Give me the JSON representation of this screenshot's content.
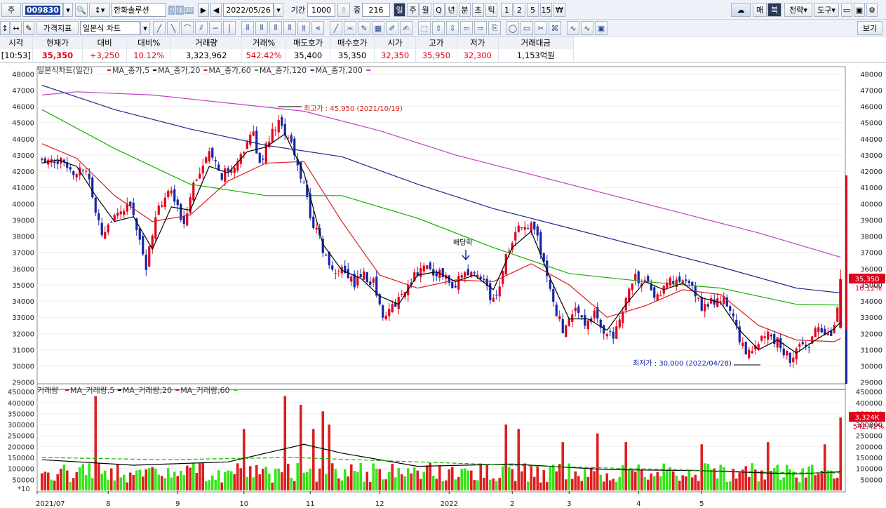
{
  "toolbar1": {
    "code_prefix": "주",
    "stock_code": "009830",
    "stock_name": "한화솔루션",
    "badges": [
      "신",
      "대",
      "30"
    ],
    "date": "2022/05/26",
    "period_label": "기간",
    "period_value": "1000",
    "zoom_label": "중",
    "zoom_value": "216",
    "periods": [
      "일",
      "주",
      "월",
      "Q",
      "년",
      "분",
      "초",
      "틱",
      "1",
      "2",
      "5",
      "15",
      "₩"
    ],
    "active_period": "일",
    "right_buttons": [
      "매",
      "복",
      "전략",
      "도구"
    ]
  },
  "toolbar2": {
    "price_indicator": "가격지표",
    "chart_type": "일본식 차트",
    "view_button": "보기"
  },
  "quote": {
    "headers": [
      "시각",
      "현재가",
      "대비",
      "대비%",
      "거래량",
      "거래%",
      "매도호가",
      "매수호가",
      "시가",
      "고가",
      "저가",
      "거래대금"
    ],
    "time": "[10:53]",
    "current": "35,350",
    "change": "+3,250",
    "change_pct": "10.12%",
    "volume": "3,323,962",
    "volume_pct": "542.42%",
    "ask": "35,400",
    "bid": "35,350",
    "open": "32,350",
    "high": "35,950",
    "low": "32,300",
    "amount": "1,153억원"
  },
  "colors": {
    "up": "#e2001a",
    "down": "#1525a8",
    "ma5": "#000000",
    "ma20": "#d91f1f",
    "ma60": "#16b000",
    "ma120": "#1b2a8f",
    "ma200": "#c33fc3",
    "vol_up": "#dd1f1f",
    "vol_down": "#37e51a"
  },
  "price_legend": {
    "title": "일본식차트(일간)",
    "items": [
      "MA_종가,5",
      "MA_종가,20",
      "MA_종가,60",
      "MA_종가,120",
      "MA_종가,200"
    ]
  },
  "volume_legend": {
    "title": "거래량",
    "items": [
      "MA_거래량,5",
      "MA_거래량,20",
      "MA_거래량,60"
    ],
    "scale_label": "*10"
  },
  "annotations": {
    "high": "최고가 : 45,950 (2021/10/19)",
    "low": "최저가 : 30,000 (2022/04/28)",
    "dividend": "배당락"
  },
  "last_price_tag": "35,350",
  "last_pct_tag": "10.12%",
  "volume_tag": "3,324K",
  "volume_pct_tag": "542.42%",
  "x_axis_labels": [
    "2021/07",
    "8",
    "9",
    "10",
    "11",
    "12",
    "2022",
    "2",
    "3",
    "4",
    "5"
  ],
  "chart_data": {
    "type": "candlestick",
    "title": "일본식차트(일간)",
    "y_ticks": [
      29000,
      30000,
      31000,
      32000,
      33000,
      34000,
      35000,
      36000,
      37000,
      38000,
      39000,
      40000,
      41000,
      42000,
      43000,
      44000,
      45000,
      46000,
      47000,
      48000
    ],
    "ylim": [
      28900,
      48100
    ],
    "volume_ticks": [
      50000,
      100000,
      150000,
      200000,
      250000,
      300000,
      350000,
      400000,
      450000
    ],
    "volume_ylim": [
      0,
      460000
    ],
    "volume_tick_labels": [
      "50000",
      "100000",
      "150000",
      "200000",
      "250000",
      "300000",
      "350000",
      "400000",
      "450000"
    ],
    "close_path": [
      [
        1,
        42600
      ],
      [
        3,
        43000
      ],
      [
        6,
        42600
      ],
      [
        9,
        42500
      ],
      [
        12,
        41900
      ],
      [
        14,
        42200
      ],
      [
        16,
        41700
      ],
      [
        18,
        39400
      ],
      [
        20,
        38300
      ],
      [
        22,
        38800
      ],
      [
        24,
        39000
      ],
      [
        26,
        39200
      ],
      [
        28,
        40000
      ],
      [
        30,
        39400
      ],
      [
        32,
        37800
      ],
      [
        34,
        36200
      ],
      [
        36,
        38000
      ],
      [
        38,
        39700
      ],
      [
        40,
        40300
      ],
      [
        42,
        40700
      ],
      [
        44,
        39600
      ],
      [
        46,
        38800
      ],
      [
        48,
        40700
      ],
      [
        50,
        41800
      ],
      [
        52,
        42300
      ],
      [
        54,
        42900
      ],
      [
        56,
        42300
      ],
      [
        58,
        41800
      ],
      [
        60,
        41900
      ],
      [
        62,
        41900
      ],
      [
        64,
        42900
      ],
      [
        66,
        43900
      ],
      [
        68,
        44300
      ],
      [
        70,
        42300
      ],
      [
        72,
        43800
      ],
      [
        74,
        44400
      ],
      [
        76,
        45100
      ],
      [
        78,
        44100
      ],
      [
        80,
        43600
      ],
      [
        82,
        42300
      ],
      [
        84,
        41300
      ],
      [
        86,
        39200
      ],
      [
        88,
        38300
      ],
      [
        90,
        37100
      ],
      [
        92,
        36200
      ],
      [
        94,
        35800
      ],
      [
        96,
        36100
      ],
      [
        98,
        35500
      ],
      [
        100,
        35100
      ],
      [
        102,
        35600
      ],
      [
        104,
        35400
      ],
      [
        106,
        35200
      ],
      [
        108,
        33800
      ],
      [
        110,
        32800
      ],
      [
        112,
        33600
      ],
      [
        114,
        34200
      ],
      [
        116,
        34700
      ],
      [
        118,
        35300
      ],
      [
        120,
        35900
      ],
      [
        122,
        36200
      ],
      [
        124,
        35800
      ],
      [
        126,
        35800
      ],
      [
        128,
        35700
      ],
      [
        130,
        35300
      ],
      [
        132,
        34900
      ],
      [
        134,
        35700
      ],
      [
        136,
        35700
      ],
      [
        138,
        35500
      ],
      [
        140,
        35600
      ],
      [
        142,
        34800
      ],
      [
        144,
        33900
      ],
      [
        146,
        35100
      ],
      [
        148,
        36700
      ],
      [
        150,
        37600
      ],
      [
        152,
        38300
      ],
      [
        154,
        38800
      ],
      [
        156,
        38500
      ],
      [
        158,
        37900
      ],
      [
        160,
        36400
      ],
      [
        162,
        34700
      ],
      [
        164,
        33300
      ],
      [
        166,
        32300
      ],
      [
        168,
        33200
      ],
      [
        170,
        33600
      ],
      [
        172,
        32700
      ],
      [
        174,
        32900
      ],
      [
        176,
        33100
      ],
      [
        178,
        32400
      ],
      [
        180,
        32100
      ],
      [
        182,
        31600
      ],
      [
        184,
        32600
      ],
      [
        186,
        34200
      ],
      [
        188,
        35400
      ],
      [
        190,
        35300
      ],
      [
        192,
        35100
      ],
      [
        194,
        34600
      ],
      [
        196,
        34300
      ],
      [
        198,
        35100
      ],
      [
        200,
        35300
      ],
      [
        202,
        35100
      ],
      [
        204,
        35000
      ],
      [
        206,
        35000
      ],
      [
        208,
        34400
      ],
      [
        210,
        33700
      ],
      [
        212,
        33800
      ],
      [
        214,
        34100
      ],
      [
        216,
        34100
      ],
      [
        218,
        33800
      ],
      [
        220,
        32800
      ],
      [
        222,
        31800
      ],
      [
        224,
        30400
      ],
      [
        226,
        31000
      ],
      [
        228,
        31600
      ],
      [
        230,
        31900
      ],
      [
        232,
        31800
      ],
      [
        234,
        31500
      ],
      [
        236,
        30800
      ],
      [
        238,
        30400
      ],
      [
        240,
        30900
      ],
      [
        242,
        31200
      ],
      [
        244,
        31400
      ],
      [
        246,
        32100
      ],
      [
        248,
        32400
      ],
      [
        250,
        31900
      ],
      [
        252,
        32300
      ],
      [
        254,
        35350
      ]
    ],
    "ma5": [
      [
        1,
        42500
      ],
      [
        6,
        42700
      ],
      [
        12,
        42300
      ],
      [
        18,
        40500
      ],
      [
        24,
        38900
      ],
      [
        30,
        39200
      ],
      [
        36,
        37200
      ],
      [
        42,
        39800
      ],
      [
        48,
        39600
      ],
      [
        54,
        42300
      ],
      [
        60,
        41900
      ],
      [
        66,
        43200
      ],
      [
        72,
        43500
      ],
      [
        78,
        44300
      ],
      [
        84,
        41900
      ],
      [
        90,
        37500
      ],
      [
        96,
        35900
      ],
      [
        102,
        35400
      ],
      [
        108,
        34300
      ],
      [
        114,
        33800
      ],
      [
        120,
        35600
      ],
      [
        126,
        35800
      ],
      [
        132,
        35200
      ],
      [
        138,
        35600
      ],
      [
        144,
        34700
      ],
      [
        150,
        37300
      ],
      [
        156,
        38300
      ],
      [
        162,
        35400
      ],
      [
        168,
        32900
      ],
      [
        174,
        32900
      ],
      [
        180,
        32200
      ],
      [
        186,
        33800
      ],
      [
        192,
        35200
      ],
      [
        198,
        34700
      ],
      [
        204,
        35100
      ],
      [
        210,
        34200
      ],
      [
        216,
        33900
      ],
      [
        222,
        32200
      ],
      [
        228,
        31000
      ],
      [
        234,
        31600
      ],
      [
        240,
        30800
      ],
      [
        246,
        31600
      ],
      [
        252,
        32300
      ],
      [
        254,
        32700
      ]
    ],
    "ma20": [
      [
        1,
        43700
      ],
      [
        12,
        42800
      ],
      [
        24,
        40500
      ],
      [
        36,
        38900
      ],
      [
        48,
        39300
      ],
      [
        60,
        41400
      ],
      [
        72,
        42500
      ],
      [
        84,
        42600
      ],
      [
        96,
        38900
      ],
      [
        108,
        35600
      ],
      [
        120,
        34800
      ],
      [
        132,
        35300
      ],
      [
        144,
        35200
      ],
      [
        156,
        36300
      ],
      [
        168,
        35000
      ],
      [
        180,
        33000
      ],
      [
        192,
        33700
      ],
      [
        204,
        34700
      ],
      [
        216,
        34400
      ],
      [
        228,
        32500
      ],
      [
        240,
        31600
      ],
      [
        252,
        31500
      ],
      [
        254,
        31700
      ]
    ],
    "ma60": [
      [
        1,
        45800
      ],
      [
        24,
        43400
      ],
      [
        48,
        41200
      ],
      [
        72,
        40500
      ],
      [
        96,
        40500
      ],
      [
        120,
        39100
      ],
      [
        144,
        37300
      ],
      [
        168,
        35700
      ],
      [
        192,
        35200
      ],
      [
        216,
        34800
      ],
      [
        240,
        33800
      ],
      [
        254,
        33750
      ]
    ],
    "ma120": [
      [
        1,
        47300
      ],
      [
        24,
        45800
      ],
      [
        48,
        44600
      ],
      [
        72,
        43600
      ],
      [
        96,
        42900
      ],
      [
        120,
        41200
      ],
      [
        144,
        39700
      ],
      [
        168,
        38500
      ],
      [
        192,
        37300
      ],
      [
        216,
        36100
      ],
      [
        240,
        34800
      ],
      [
        254,
        34500
      ]
    ],
    "ma200": [
      [
        1,
        46700
      ],
      [
        12,
        46900
      ],
      [
        36,
        46700
      ],
      [
        60,
        46200
      ],
      [
        84,
        45700
      ],
      [
        108,
        44500
      ],
      [
        132,
        43000
      ],
      [
        156,
        41800
      ],
      [
        180,
        40600
      ],
      [
        204,
        39400
      ],
      [
        228,
        38200
      ],
      [
        254,
        36700
      ]
    ],
    "volume_series": {
      "spike_up": [
        [
          18,
          430000
        ],
        [
          65,
          280000
        ],
        [
          78,
          430000
        ],
        [
          83,
          390000
        ],
        [
          87,
          280000
        ],
        [
          90,
          360000
        ],
        [
          92,
          300000
        ],
        [
          148,
          300000
        ],
        [
          152,
          280000
        ],
        [
          166,
          220000
        ],
        [
          177,
          260000
        ],
        [
          186,
          220000
        ],
        [
          210,
          210000
        ],
        [
          231,
          220000
        ],
        [
          249,
          210000
        ],
        [
          254,
          332400
        ]
      ],
      "baseline_avg": 90000
    },
    "vol_ma20": [
      [
        1,
        140000
      ],
      [
        30,
        115000
      ],
      [
        60,
        130000
      ],
      [
        84,
        210000
      ],
      [
        96,
        170000
      ],
      [
        120,
        110000
      ],
      [
        150,
        120000
      ],
      [
        180,
        95000
      ],
      [
        210,
        90000
      ],
      [
        240,
        75000
      ],
      [
        254,
        85000
      ]
    ],
    "vol_ma60": [
      [
        1,
        150000
      ],
      [
        40,
        140000
      ],
      [
        80,
        150000
      ],
      [
        120,
        130000
      ],
      [
        160,
        110000
      ],
      [
        200,
        95000
      ],
      [
        240,
        80000
      ],
      [
        254,
        80000
      ]
    ]
  }
}
